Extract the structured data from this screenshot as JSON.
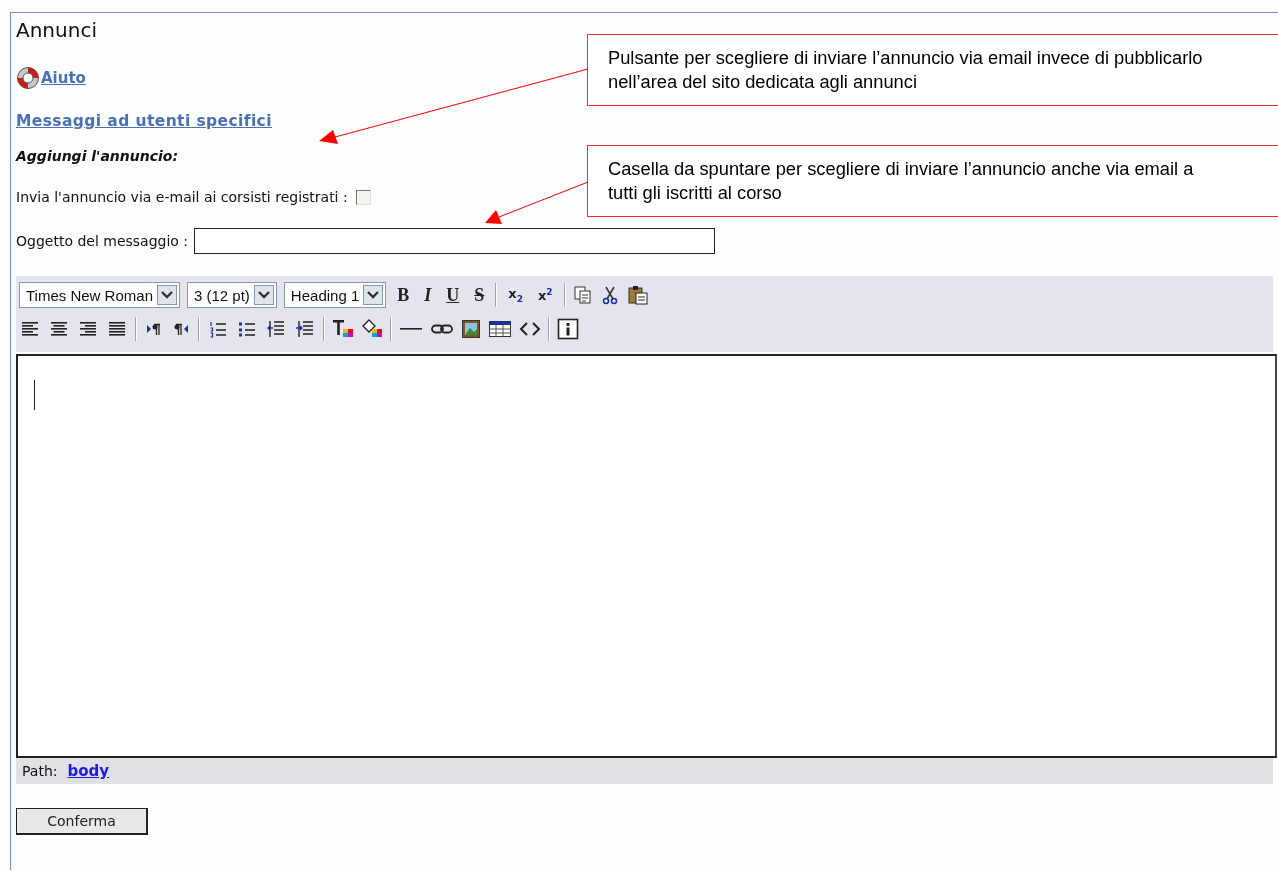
{
  "page": {
    "title": "Annunci"
  },
  "help_link": {
    "label": "Aiuto"
  },
  "recipients_link": {
    "label": "Messaggi ad utenti specifici"
  },
  "section_title": "Aggiungi l'annuncio:",
  "email_option": {
    "label": "Invia l'annuncio via e-mail ai corsisti registrati :",
    "checked": false
  },
  "subject": {
    "label": "Oggetto del messaggio :"
  },
  "editor": {
    "selects": [
      {
        "value": "Times New Roman"
      },
      {
        "value": "3 (12 pt)"
      },
      {
        "value": "Heading 1"
      }
    ],
    "format_buttons": [
      {
        "label": "B",
        "kind": "bold"
      },
      {
        "label": "I",
        "kind": "italic"
      },
      {
        "label": "U",
        "kind": "underline"
      },
      {
        "label": "S",
        "kind": "strike"
      }
    ],
    "script_buttons": [
      "x$_{2}$",
      "x$^{2}$"
    ],
    "path_label": "Path:",
    "path_link": "body"
  },
  "submit": {
    "label": "Conferma"
  },
  "callouts": [
    {
      "text": "Pulsante per scegliere di inviare l’annuncio via email invece di pubblicarlo nell’area del sito dedicata agli annunci"
    },
    {
      "text": "Casella da spuntare per scegliere di inviare l’annuncio anche via email a tutti gli iscritti al corso"
    }
  ]
}
